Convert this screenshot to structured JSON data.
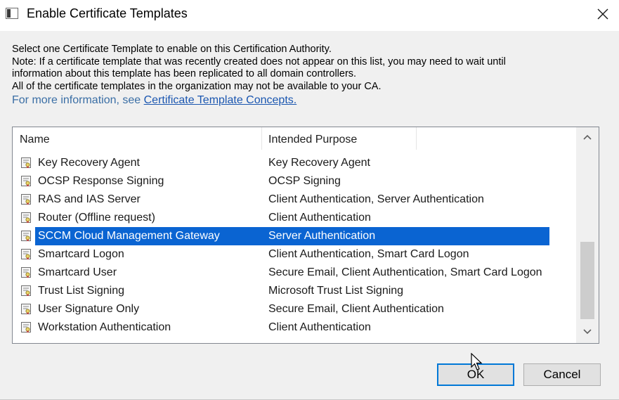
{
  "window": {
    "title": "Enable Certificate Templates"
  },
  "info": {
    "line1": "Select one Certificate Template to enable on this Certification Authority.",
    "line2": "Note: If a certificate template that was recently created does not appear on this list, you may need to wait until",
    "line3": "information about this template has been replicated to all domain controllers.",
    "line4": "All of the certificate templates in the organization may not be available to your CA.",
    "more_info_prefix": "For more information, see ",
    "more_info_link": "Certificate Template Concepts."
  },
  "list": {
    "columns": [
      "Name",
      "Intended Purpose"
    ],
    "rows": [
      {
        "name": "Key Recovery Agent",
        "purpose": "Key Recovery Agent"
      },
      {
        "name": "OCSP Response Signing",
        "purpose": "OCSP Signing"
      },
      {
        "name": "RAS and IAS Server",
        "purpose": "Client Authentication, Server Authentication"
      },
      {
        "name": "Router (Offline request)",
        "purpose": "Client Authentication"
      },
      {
        "name": "SCCM Cloud Management Gateway",
        "purpose": "Server Authentication"
      },
      {
        "name": "Smartcard Logon",
        "purpose": "Client Authentication, Smart Card Logon"
      },
      {
        "name": "Smartcard User",
        "purpose": "Secure Email, Client Authentication, Smart Card Logon"
      },
      {
        "name": "Trust List Signing",
        "purpose": "Microsoft Trust List Signing"
      },
      {
        "name": "User Signature Only",
        "purpose": "Secure Email, Client Authentication"
      },
      {
        "name": "Workstation Authentication",
        "purpose": "Client Authentication"
      }
    ],
    "selected_index": 4
  },
  "buttons": {
    "ok": "OK",
    "cancel": "Cancel"
  },
  "colors": {
    "selection": "#0a64d2",
    "link": "#1a56b0",
    "accent_border": "#0078d7"
  },
  "icons": {
    "app": "certificate-authority-icon",
    "close": "close-icon",
    "row": "certificate-template-icon",
    "scroll_up": "chevron-up-icon",
    "scroll_down": "chevron-down-icon"
  }
}
